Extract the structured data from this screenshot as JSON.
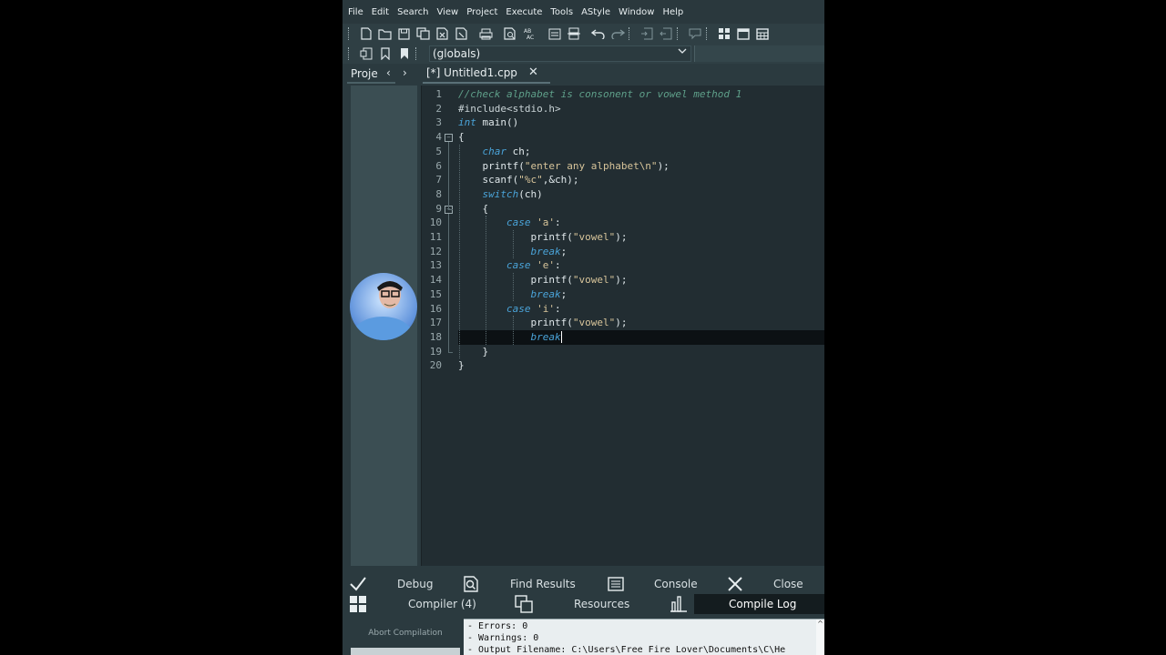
{
  "menu": [
    "File",
    "Edit",
    "Search",
    "View",
    "Project",
    "Execute",
    "Tools",
    "AStyle",
    "Window",
    "Help"
  ],
  "toolbar": {
    "scope_select": "(globals)"
  },
  "tabs": {
    "project": "Proje",
    "file": "[*] Untitled1.cpp"
  },
  "editor": {
    "current_line": 18,
    "lines": [
      "1",
      "2",
      "3",
      "4",
      "5",
      "6",
      "7",
      "8",
      "9",
      "10",
      "11",
      "12",
      "13",
      "14",
      "15",
      "16",
      "17",
      "18",
      "19",
      "20"
    ],
    "code": [
      [
        {
          "t": "//check alphabet is consonent or vowel method 1",
          "c": "com"
        }
      ],
      [
        {
          "t": "#include<stdio.h>",
          "c": "pp"
        }
      ],
      [
        {
          "t": "int",
          "c": "kw"
        },
        {
          "t": " main()",
          "c": ""
        }
      ],
      [
        {
          "t": "{",
          "c": ""
        }
      ],
      [
        {
          "t": "    ",
          "c": ""
        },
        {
          "t": "char",
          "c": "kw"
        },
        {
          "t": " ch;",
          "c": ""
        }
      ],
      [
        {
          "t": "    printf(",
          "c": ""
        },
        {
          "t": "\"enter any alphabet\\n\"",
          "c": "str"
        },
        {
          "t": ");",
          "c": ""
        }
      ],
      [
        {
          "t": "    scanf(",
          "c": ""
        },
        {
          "t": "\"%c\"",
          "c": "str"
        },
        {
          "t": ",&ch);",
          "c": ""
        }
      ],
      [
        {
          "t": "    ",
          "c": ""
        },
        {
          "t": "switch",
          "c": "kw"
        },
        {
          "t": "(ch)",
          "c": ""
        }
      ],
      [
        {
          "t": "    {",
          "c": ""
        }
      ],
      [
        {
          "t": "        ",
          "c": ""
        },
        {
          "t": "case",
          "c": "kw"
        },
        {
          "t": " ",
          "c": ""
        },
        {
          "t": "'a'",
          "c": "str"
        },
        {
          "t": ":",
          "c": ""
        }
      ],
      [
        {
          "t": "            printf(",
          "c": ""
        },
        {
          "t": "\"vowel\"",
          "c": "str"
        },
        {
          "t": ");",
          "c": ""
        }
      ],
      [
        {
          "t": "            ",
          "c": ""
        },
        {
          "t": "break",
          "c": "kw"
        },
        {
          "t": ";",
          "c": ""
        }
      ],
      [
        {
          "t": "        ",
          "c": ""
        },
        {
          "t": "case",
          "c": "kw"
        },
        {
          "t": " ",
          "c": ""
        },
        {
          "t": "'e'",
          "c": "str"
        },
        {
          "t": ":",
          "c": ""
        }
      ],
      [
        {
          "t": "            printf(",
          "c": ""
        },
        {
          "t": "\"vowel\"",
          "c": "str"
        },
        {
          "t": ");",
          "c": ""
        }
      ],
      [
        {
          "t": "            ",
          "c": ""
        },
        {
          "t": "break",
          "c": "kw"
        },
        {
          "t": ";",
          "c": ""
        }
      ],
      [
        {
          "t": "        ",
          "c": ""
        },
        {
          "t": "case",
          "c": "kw"
        },
        {
          "t": " ",
          "c": ""
        },
        {
          "t": "'i'",
          "c": "str"
        },
        {
          "t": ":",
          "c": ""
        }
      ],
      [
        {
          "t": "            printf(",
          "c": ""
        },
        {
          "t": "\"vowel\"",
          "c": "str"
        },
        {
          "t": ");",
          "c": ""
        }
      ],
      [
        {
          "t": "            ",
          "c": ""
        },
        {
          "t": "break",
          "c": "kw"
        }
      ],
      [
        {
          "t": "    }",
          "c": ""
        }
      ],
      [
        {
          "t": "}",
          "c": ""
        }
      ]
    ]
  },
  "bottom": {
    "row1": [
      "Debug",
      "Find Results",
      "Console",
      "Close"
    ],
    "row2": [
      "Compiler (4)",
      "Resources",
      "Compile Log"
    ],
    "abort_label": "Abort Compilation",
    "log": [
      "- Errors: 0",
      "- Warnings: 0",
      "- Output Filename: C:\\Users\\Free Fire Lover\\Documents\\C\\He"
    ]
  }
}
